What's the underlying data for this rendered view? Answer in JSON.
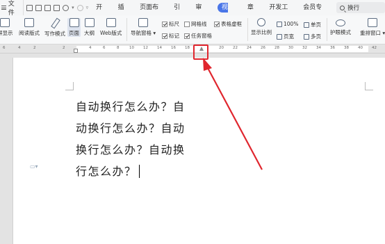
{
  "menubar": {
    "file_label": "文件",
    "tabs": [
      "开始",
      "插入",
      "页面布局",
      "引用",
      "审阅",
      "视图",
      "章节",
      "开发工具",
      "会员专享"
    ],
    "active_tab": "视图",
    "search_label": "换行"
  },
  "ribbon": {
    "buttons": {
      "fullscreen": "屏显示",
      "reading": "阅读版式",
      "writing": "写作模式",
      "page": "页面",
      "outline": "大纲",
      "web": "Web版式",
      "nav": "导航窗格",
      "zoom": "显示比例",
      "eye": "护眼模式",
      "rearrange": "重排窗口"
    },
    "checks": {
      "ruler": "标尺",
      "gridlines": "网格线",
      "table_borders": "表格虚框",
      "marks": "标记",
      "task_pane": "任务窗格"
    },
    "small": {
      "zoom100": "100%",
      "single": "单页",
      "page_width": "页宽",
      "multi": "多页"
    }
  },
  "ruler_ticks": [
    "6",
    "4",
    "2",
    "",
    "2",
    "4",
    "6",
    "8",
    "10",
    "12",
    "14",
    "16",
    "18",
    "20",
    "22",
    "24",
    "26",
    "28",
    "30",
    "32",
    "34",
    "36",
    "38",
    "40",
    "42"
  ],
  "document": {
    "lines": [
      "自动换行怎么办？自",
      "动换行怎么办？自动",
      "换行怎么办？自动换",
      "行怎么办？"
    ]
  },
  "colors": {
    "accent": "#4a76e8",
    "annotation": "#e0262e"
  }
}
